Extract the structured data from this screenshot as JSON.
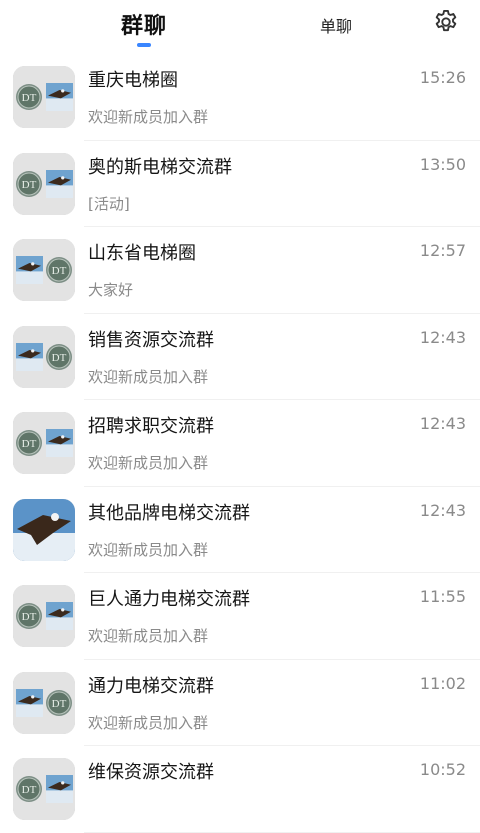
{
  "tabs": {
    "group_label": "群聊",
    "single_label": "单聊",
    "settings_icon": "gear-icon"
  },
  "avatar_logo_text": "DT",
  "chats": [
    {
      "name": "重庆电梯圈",
      "preview": "欢迎新成员加入群",
      "time": "15:26",
      "avatar": "dt-left"
    },
    {
      "name": "奥的斯电梯交流群",
      "preview": "[活动]",
      "time": "13:50",
      "avatar": "dt-left"
    },
    {
      "name": "山东省电梯圈",
      "preview": "大家好",
      "time": "12:57",
      "avatar": "eagle-left"
    },
    {
      "name": "销售资源交流群",
      "preview": "欢迎新成员加入群",
      "time": "12:43",
      "avatar": "eagle-left"
    },
    {
      "name": "招聘求职交流群",
      "preview": "欢迎新成员加入群",
      "time": "12:43",
      "avatar": "dt-left"
    },
    {
      "name": "其他品牌电梯交流群",
      "preview": "欢迎新成员加入群",
      "time": "12:43",
      "avatar": "eagle-full"
    },
    {
      "name": "巨人通力电梯交流群",
      "preview": "欢迎新成员加入群",
      "time": "11:55",
      "avatar": "dt-left"
    },
    {
      "name": "通力电梯交流群",
      "preview": "欢迎新成员加入群",
      "time": "11:02",
      "avatar": "eagle-left"
    },
    {
      "name": "维保资源交流群",
      "preview": "",
      "time": "10:52",
      "avatar": "dt-left"
    }
  ]
}
